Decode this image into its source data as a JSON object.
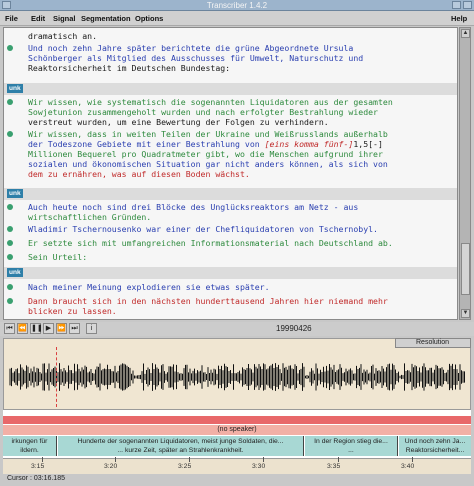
{
  "window": {
    "title": "Transcriber 1.4.2"
  },
  "menu": {
    "file": "File",
    "edit": "Edit",
    "signal": "Signal",
    "segmentation": "Segmentation",
    "options": "Options",
    "help": "Help"
  },
  "editor": {
    "l1": "dramatisch an.",
    "l2a": "Und ",
    "l2b": "noch zehn Jahre später berichtete die ",
    "l2c": "grüne",
    " l2d": "",
    "l2": "noch zehn Jahre später berichtete die grüne Abgeordnete Ursula",
    "l3": "Schönberger als Mitglied des Ausschusses für Umwelt, Naturschutz und",
    "l4": "Reaktorsicherheit im Deutschen Bundestag:",
    "tag1": "unk",
    "l5": "Wir wissen, wie systematisch die sogenannten Liquidatoren aus der gesamten",
    "l6": "Sowjetunion zusammengeholt wurden und nach erfolgter Bestrahlung wieder",
    "l7": "verstreut wurden, um eine Bewertung der Folgen zu verhindern.",
    "l8": "Wir wissen, dass in weiten Teilen der Ukraine und Weißrusslands außerhalb",
    "l9a": "der Todeszone Gebiete mit einer Bestrahlung von ",
    "l9b": "[eins komma fünf-]",
    "l9c": "1,5[-]",
    "l10": "Millionen Bequerel pro Quadratmeter gibt, wo die Menschen aufgrund ihrer",
    "l11": "sozialen und ökonomischen Situation gar nicht anders können, als sich von",
    "l12": "dem zu ernähren, was auf diesen Boden wächst.",
    "tag2": "unk",
    "l13": "Auch heute noch sind drei Blöcke des Unglücksreaktors am Netz - aus",
    "l14": "wirtschaftlichen Gründen.",
    "l15": "Wladimir Tschernousenko war einer der Chefliquidatoren von Tschernobyl.",
    "l16": "Er setzte sich mit umfangreichen Informationsmaterial nach Deutschland ab.",
    "l17": "Sein Urteil:",
    "tag3": "unk",
    "l18": "Nach meiner Meinung explodieren sie etwas später.",
    "l19": "Dann braucht sich in den nächsten hunderttausend Jahren hier niemand mehr",
    "l20": "blicken zu lassen."
  },
  "controls": {
    "filename": "19990426"
  },
  "resolution": "Resolution",
  "segments": {
    "speaker": "(no speaker)",
    "s1a": "irkungen für",
    "s1b": "ildern.",
    "s2a": "Hunderte der sogenannten Liquidatoren, meist junge Soldaten, die...",
    "s2b": "... kurze Zeit, später an Strahlenkrankheit.",
    "s3a": "In der Region stieg die...",
    "s3b": "...",
    "s4a": "Und noch zehn Ja...",
    "s4b": "Reaktorsicherheit..."
  },
  "axis": {
    "t1": "3:15",
    "t2": "3:20",
    "t3": "3:25",
    "t4": "3:30",
    "t5": "3:35",
    "t6": "3:40"
  },
  "status": {
    "cursor": "Cursor : 03:16.185"
  },
  "colors": {
    "green": "#2e8a3e",
    "red": "#c02a2a",
    "blue": "#2a3fb0",
    "tag": "#2e7fa8",
    "segment": "#a8d8d4"
  }
}
